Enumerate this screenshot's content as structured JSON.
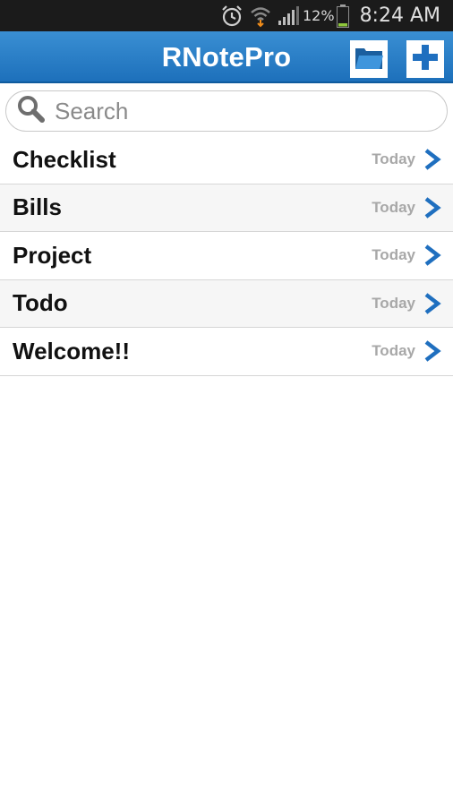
{
  "status_bar": {
    "icons": [
      "alarm-icon",
      "wifi-icon",
      "signal-icon",
      "battery-icon"
    ],
    "battery_percent": "12%",
    "time": "8:24 AM"
  },
  "app_bar": {
    "title": "RNotePro",
    "folder_icon": "folder-icon",
    "add_icon": "plus-icon",
    "accent_color": "#1d70bb"
  },
  "search": {
    "placeholder": "Search",
    "value": ""
  },
  "notes": [
    {
      "title": "Checklist",
      "date": "Today"
    },
    {
      "title": "Bills",
      "date": "Today"
    },
    {
      "title": "Project",
      "date": "Today"
    },
    {
      "title": "Todo",
      "date": "Today"
    },
    {
      "title": "Welcome!!",
      "date": "Today"
    }
  ]
}
